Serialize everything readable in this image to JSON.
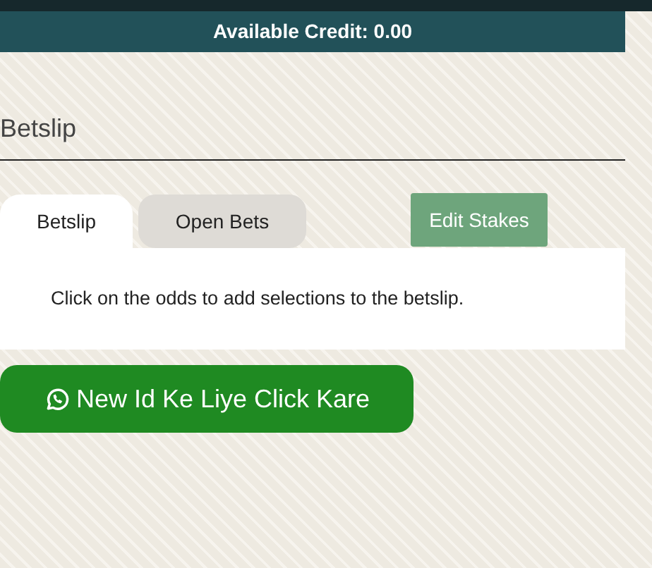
{
  "credit_bar": {
    "text": "Available Credit: 0.00"
  },
  "betslip_heading": "Betslip",
  "tabs": [
    {
      "label": "Betslip",
      "selected": true
    },
    {
      "label": "Open Bets",
      "selected": false
    }
  ],
  "edit_stakes_button": "Edit Stakes",
  "empty_message": "Click on the odds to add selections to the betslip.",
  "whatsapp_button": "New Id Ke Liye Click Kare"
}
